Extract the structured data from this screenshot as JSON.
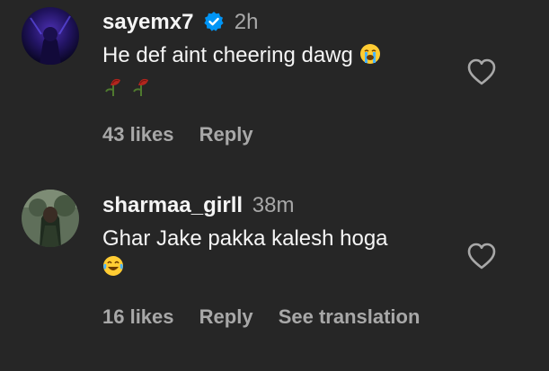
{
  "comments": [
    {
      "username": "sayemx7",
      "verified": true,
      "time": "2h",
      "text": "He def aint cheering dawg",
      "emojis_line1": "loudly-crying-face",
      "emojis_line2": [
        "wilted-rose",
        "wilted-rose"
      ],
      "likes": "43 likes",
      "reply": "Reply"
    },
    {
      "username": "sharmaa_girll",
      "verified": false,
      "time": "38m",
      "text": "Ghar Jake pakka kalesh hoga",
      "emojis_line2": [
        "face-with-tears-of-joy"
      ],
      "likes": "16 likes",
      "reply": "Reply",
      "see_translation": "See translation"
    }
  ],
  "colors": {
    "background": "#262626",
    "primary_text": "#f5f5f5",
    "secondary_text": "#a8a8a8",
    "verified_badge": "#0095f6"
  }
}
